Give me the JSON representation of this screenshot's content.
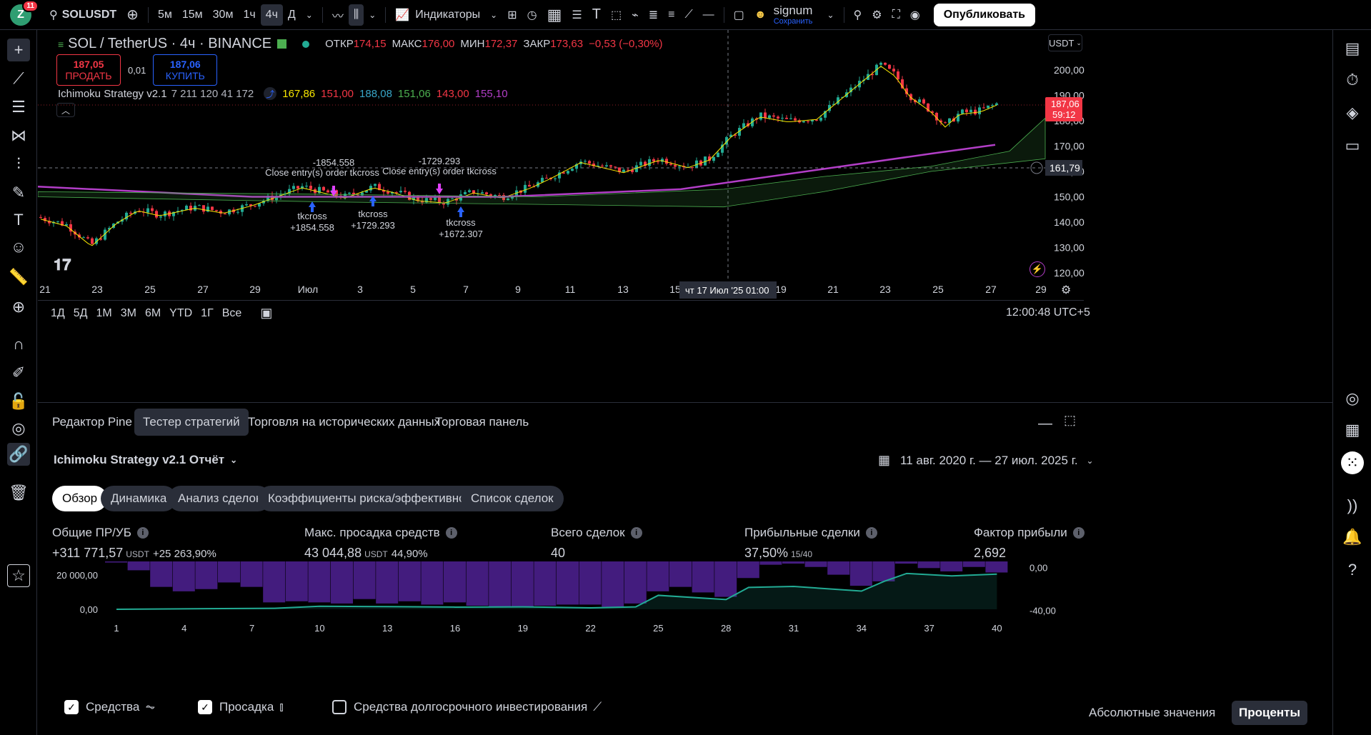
{
  "topbar": {
    "avatar_letter": "Z",
    "notif_count": "11",
    "symbol": "SOLUSDT",
    "intervals": [
      "5м",
      "15м",
      "30м",
      "1ч",
      "4ч",
      "Д"
    ],
    "active_interval": "4ч",
    "indicators_label": "Индикаторы",
    "user_name": "signum",
    "save_label": "Сохранить",
    "publish_label": "Опубликовать"
  },
  "legend": {
    "symbol_title": "SOL / TetherUS · 4ч · BINANCE",
    "open_lbl": "ОТКР",
    "open": "174,15",
    "high_lbl": "МАКС",
    "high": "176,00",
    "low_lbl": "МИН",
    "low": "172,37",
    "close_lbl": "ЗАКР",
    "close": "173,63",
    "change": "−0,53 (−0,30%)",
    "sell_price": "187,05",
    "sell_label": "ПРОДАТЬ",
    "spread": "0,01",
    "buy_price": "187,06",
    "buy_label": "КУПИТЬ",
    "strategy_name": "Ichimoku Strategy v2.1",
    "strategy_params": "7 211 120 41 172",
    "ind_values": [
      {
        "v": "167,86",
        "c": "#f7e600"
      },
      {
        "v": "151,00",
        "c": "#f23645"
      },
      {
        "v": "188,08",
        "c": "#38a6c8"
      },
      {
        "v": "151,06",
        "c": "#4caf50"
      },
      {
        "v": "143,00",
        "c": "#f23645"
      },
      {
        "v": "155,10",
        "c": "#b23ec7"
      }
    ]
  },
  "price_axis": {
    "currency": "USDT",
    "ticks": [
      "200,00",
      "190,00",
      "180,00",
      "170,00",
      "160,00",
      "150,00",
      "140,00",
      "130,00",
      "120,00"
    ],
    "last_price": "187,06",
    "countdown": "59:12",
    "crosshair_price": "161,79"
  },
  "time_axis": {
    "ticks": [
      "21",
      "23",
      "25",
      "27",
      "29",
      "Июл",
      "3",
      "5",
      "7",
      "9",
      "11",
      "13",
      "15",
      "19",
      "21",
      "23",
      "25",
      "27",
      "29"
    ],
    "crosshair_date": "чт 17 Июл '25",
    "crosshair_time": "01:00"
  },
  "trade_labels": [
    {
      "text": "-1854.558"
    },
    {
      "text": "Close entry(s) order tkcross"
    },
    {
      "text": "-1729.293"
    },
    {
      "text": "Close entry(s) order tkcross"
    },
    {
      "text": "tkcross"
    },
    {
      "text": "+1854.558"
    },
    {
      "text": "tkcross"
    },
    {
      "text": "+1729.293"
    },
    {
      "text": "tkcross"
    },
    {
      "text": "+1672.307"
    }
  ],
  "range_bar": {
    "ranges": [
      "1Д",
      "5Д",
      "1М",
      "3М",
      "6М",
      "YTD",
      "1Г",
      "Все"
    ],
    "clock": "12:00:48 UTC+5"
  },
  "panel": {
    "tabs": [
      "Редактор Pine",
      "Тестер стратегий",
      "Торговля на исторических данных",
      "Торговая панель"
    ],
    "active_tab": "Тестер стратегий",
    "report_title": "Ichimoku Strategy v2.1 Отчёт",
    "date_range": "11 авг. 2020 г. — 27 июл. 2025 г.",
    "subtabs": [
      "Обзор",
      "Динамика",
      "Анализ сделок",
      "Коэффициенты риска/эффективности",
      "Список сделок"
    ],
    "active_subtab": "Обзор",
    "metrics": [
      {
        "label": "Общие ПР/УБ",
        "value": "+311 771,57",
        "unit": "USDT",
        "extra": "+25 263,90%"
      },
      {
        "label": "Макс. просадка средств",
        "value": "43 044,88",
        "unit": "USDT",
        "extra": "44,90%"
      },
      {
        "label": "Всего сделок",
        "value": "40",
        "unit": "",
        "extra": ""
      },
      {
        "label": "Прибыльные сделки",
        "value": "37,50%",
        "unit": "15/40",
        "extra": ""
      },
      {
        "label": "Фактор прибыли",
        "value": "2,692",
        "unit": "",
        "extra": ""
      }
    ],
    "checkboxes": [
      {
        "label": "Средства",
        "checked": true
      },
      {
        "label": "Просадка",
        "checked": true
      },
      {
        "label": "Средства долгосрочного инвестирования",
        "checked": false
      }
    ],
    "abs_label": "Абсолютные значения",
    "pct_label": "Проценты"
  },
  "chart_data": [
    {
      "type": "line",
      "title": "",
      "y_left_ticks": [
        "20 000,00",
        "0,00"
      ],
      "y_right_ticks": [
        "0,00",
        "-40,00"
      ],
      "x_ticks": [
        "1",
        "4",
        "7",
        "10",
        "13",
        "16",
        "19",
        "22",
        "25",
        "28",
        "31",
        "34",
        "37",
        "40"
      ],
      "series": [
        {
          "name": "Средства",
          "type": "line",
          "color": "#22ab94",
          "x": [
            1,
            5,
            8,
            10,
            13,
            16,
            19,
            22,
            24,
            25,
            28,
            29,
            31,
            34,
            35,
            36,
            38,
            40
          ],
          "values": [
            0,
            500,
            800,
            2500,
            2200,
            1800,
            2000,
            1200,
            2000,
            11500,
            8000,
            18000,
            18800,
            15000,
            23000,
            29500,
            27500,
            29000
          ]
        },
        {
          "name": "Просадка",
          "type": "bar",
          "color": "#4a1f8c",
          "x": [
            1,
            2,
            3,
            4,
            5,
            6,
            7,
            8,
            9,
            10,
            11,
            12,
            13,
            14,
            15,
            16,
            17,
            18,
            19,
            20,
            21,
            22,
            23,
            24,
            25,
            26,
            27,
            28,
            29,
            30,
            31,
            32,
            33,
            34,
            35,
            36,
            37,
            38,
            39,
            40
          ],
          "values": [
            -1,
            -8,
            -23,
            -27,
            -25,
            -19,
            -23,
            -37,
            -36,
            -37,
            -38,
            -34,
            -38,
            -36,
            -39,
            -37,
            -40,
            -41,
            -41,
            -40,
            -39,
            -39,
            -41,
            -38,
            -27,
            -23,
            -28,
            -32,
            -15,
            -3,
            -2,
            -5,
            -12,
            -22,
            -18,
            -2,
            -6,
            -9,
            -5,
            -10
          ]
        }
      ]
    }
  ]
}
